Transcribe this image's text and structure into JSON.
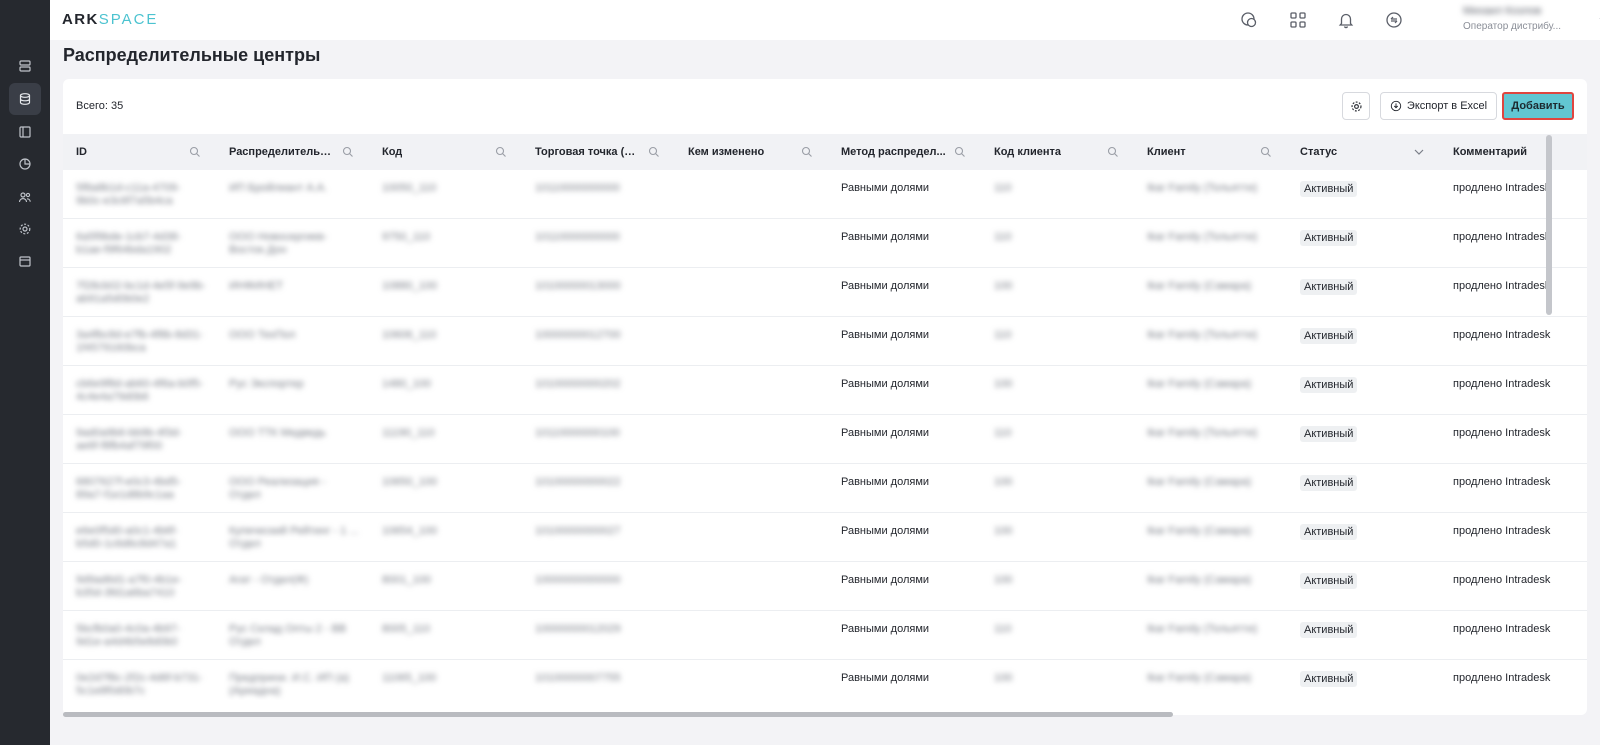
{
  "app": {
    "logo_part1": "ARK",
    "logo_part2": "SPACE"
  },
  "sidebar": {
    "items": [
      {
        "icon": "server-icon"
      },
      {
        "icon": "database-icon",
        "active": true
      },
      {
        "icon": "layout-icon"
      },
      {
        "icon": "pie-chart-icon"
      },
      {
        "icon": "users-icon"
      },
      {
        "icon": "gear-icon"
      },
      {
        "icon": "calendar-icon"
      }
    ]
  },
  "header": {
    "icons": [
      "chat-icon",
      "apps-grid-icon",
      "bell-icon",
      "exchange-icon"
    ],
    "user_name": "Михаил Козлов",
    "user_role": "Оператор дистрибу..."
  },
  "page": {
    "title": "Распределительные центры",
    "total": "Всего: 35",
    "export_label": "Экспорт в Excel",
    "add_label": "Добавить"
  },
  "table": {
    "columns": [
      "ID",
      "Распределительн...",
      "Код",
      "Торговая точка (о...",
      "Кем изменено",
      "Метод распредел...",
      "Код клиента",
      "Клиент",
      "Статус",
      "Комментарий"
    ],
    "rows": [
      {
        "id": "5f8a8b1d-c11a-4709-9b0c-e3c6f7a5b4ca",
        "dc": "ИП Бройлиант А.А.",
        "code": "10050_110",
        "outlet": "10110000000000",
        "changed_by": "",
        "method": "Равными долями",
        "client_code": "110",
        "client": "Ikar Family (Тольятти)",
        "status": "Активный",
        "comment": "продлено Intradesk"
      },
      {
        "id": "6a5f9bde-1cb7-4d38-b1ae-f9f64bda1902",
        "dc": "ООО Новосергиев-Восток Дон",
        "code": "9750_110",
        "outlet": "10110000000000",
        "changed_by": "",
        "method": "Равными долями",
        "client_code": "110",
        "client": "Ikar Family (Тольятти)",
        "status": "Активный",
        "comment": "продлено Intradesk"
      },
      {
        "id": "7f28cb02-bc1d-4e5f-9e9b-ab91a5d0b0e2",
        "dc": "ИНФИНЕТ",
        "code": "10880_100",
        "outlet": "10100000013000",
        "changed_by": "",
        "method": "Равными долями",
        "client_code": "100",
        "client": "Ikar Family (Самара)",
        "status": "Активный",
        "comment": "продлено Intradesk"
      },
      {
        "id": "3a4fbc8d-e7fb-4f8b-8d31-1f4579160bca",
        "dc": "ООО ТехПол",
        "code": "10606_110",
        "outlet": "10000000012700",
        "changed_by": "",
        "method": "Равными долями",
        "client_code": "110",
        "client": "Ikar Family (Тольятти)",
        "status": "Активный",
        "comment": "продлено Intradesk"
      },
      {
        "id": "cb6e9f8d-ab60-4f6a-b0f5-4c4e4a79d0b6",
        "dc": "Рус Экспортер",
        "code": "1480_100",
        "outlet": "10100000000202",
        "changed_by": "",
        "method": "Равными долями",
        "client_code": "100",
        "client": "Ikar Family (Самара)",
        "status": "Активный",
        "comment": "продлено Intradesk"
      },
      {
        "id": "9ad0a9b6-bb9b-4f3d-ae6f-f8fb4af79f00",
        "dc": "ООО ТТК Медведь",
        "code": "11190_110",
        "outlet": "10110000000100",
        "changed_by": "",
        "method": "Равными долями",
        "client_code": "110",
        "client": "Ikar Family (Тольятти)",
        "status": "Активный",
        "comment": "продлено Intradesk"
      },
      {
        "id": "6807627f-e0c3-4bd5-89a7-f1e1d8b9c1aa",
        "dc": "ООО Реализация - Отдел",
        "code": "10650_100",
        "outlet": "10100000000022",
        "changed_by": "",
        "method": "Равными долями",
        "client_code": "100",
        "client": "Ikar Family (Самара)",
        "status": "Активный",
        "comment": "продлено Intradesk"
      },
      {
        "id": "e6e0f5d0-a0c1-4b6f-b5d0-1c6d6c8d47a1",
        "dc": "Купеческий Рейтинг - 1 ... Отдел",
        "code": "10654_100",
        "outlet": "10100000000027",
        "changed_by": "",
        "method": "Равными долями",
        "client_code": "100",
        "client": "Ikar Family (Самара)",
        "status": "Активный",
        "comment": "продлено Intradesk"
      },
      {
        "id": "9d9ad6d1-a7f0-4b1e-b35d-3fd1a6ba7410",
        "dc": "Агат - Отдел(Ф)",
        "code": "8001_100",
        "outlet": "10000000000000",
        "changed_by": "",
        "method": "Равными долями",
        "client_code": "100",
        "client": "Ikar Family (Самара)",
        "status": "Активный",
        "comment": "продлено Intradesk"
      },
      {
        "id": "5bcfb0a0-4c0a-4b97-9d1e-a4d4b5e8d0b0",
        "dc": "Рус Склад Опты 2 - ВВ Отдел",
        "code": "8005_110",
        "outlet": "10000000012029",
        "changed_by": "",
        "method": "Равными долями",
        "client_code": "110",
        "client": "Ikar Family (Тольятти)",
        "status": "Активный",
        "comment": "продлено Intradesk"
      },
      {
        "id": "0e2d7f8c-2f2c-4d6f-b731-5c1e8f0d0b7c",
        "dc": "Предприни. И.С. ИП (а) (Ариадна)",
        "code": "11065_100",
        "outlet": "10100000007755",
        "changed_by": "",
        "method": "Равными долями",
        "client_code": "100",
        "client": "Ikar Family (Самара)",
        "status": "Активный",
        "comment": "продлено Intradesk"
      }
    ]
  }
}
